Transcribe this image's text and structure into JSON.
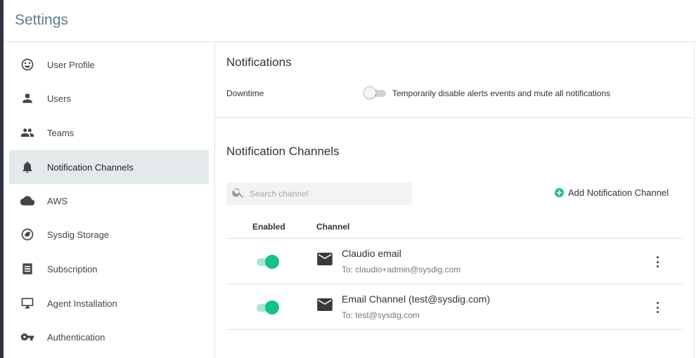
{
  "app": {
    "title": "Settings"
  },
  "sidebar": {
    "items": [
      {
        "label": "User Profile",
        "icon": "smiley-icon",
        "active": false
      },
      {
        "label": "Users",
        "icon": "person-icon",
        "active": false
      },
      {
        "label": "Teams",
        "icon": "group-icon",
        "active": false
      },
      {
        "label": "Notification Channels",
        "icon": "bell-icon",
        "active": true
      },
      {
        "label": "AWS",
        "icon": "cloud-icon",
        "active": false
      },
      {
        "label": "Sysdig Storage",
        "icon": "storage-icon",
        "active": false
      },
      {
        "label": "Subscription",
        "icon": "receipt-icon",
        "active": false
      },
      {
        "label": "Agent Installation",
        "icon": "monitor-icon",
        "active": false
      },
      {
        "label": "Authentication",
        "icon": "key-icon",
        "active": false
      }
    ]
  },
  "notifications": {
    "title": "Notifications",
    "downtime_label": "Downtime",
    "downtime_enabled": false,
    "downtime_description": "Temporarily disable alerts events and mute all notifications"
  },
  "channels": {
    "title": "Notification Channels",
    "search_placeholder": "Search channel",
    "search_value": "",
    "add_label": "Add Notification Channel",
    "columns": {
      "enabled": "Enabled",
      "channel": "Channel"
    },
    "rows": [
      {
        "name": "Claudio email",
        "to": "To: claudio+admin@sysdig.com",
        "enabled": true
      },
      {
        "name": "Email Channel (test@sysdig.com)",
        "to": "To: test@sysdig.com",
        "enabled": true
      }
    ]
  },
  "colors": {
    "accent": "#12c18b",
    "active_nav": "#e4eaeb",
    "title": "#5e7d8c"
  }
}
